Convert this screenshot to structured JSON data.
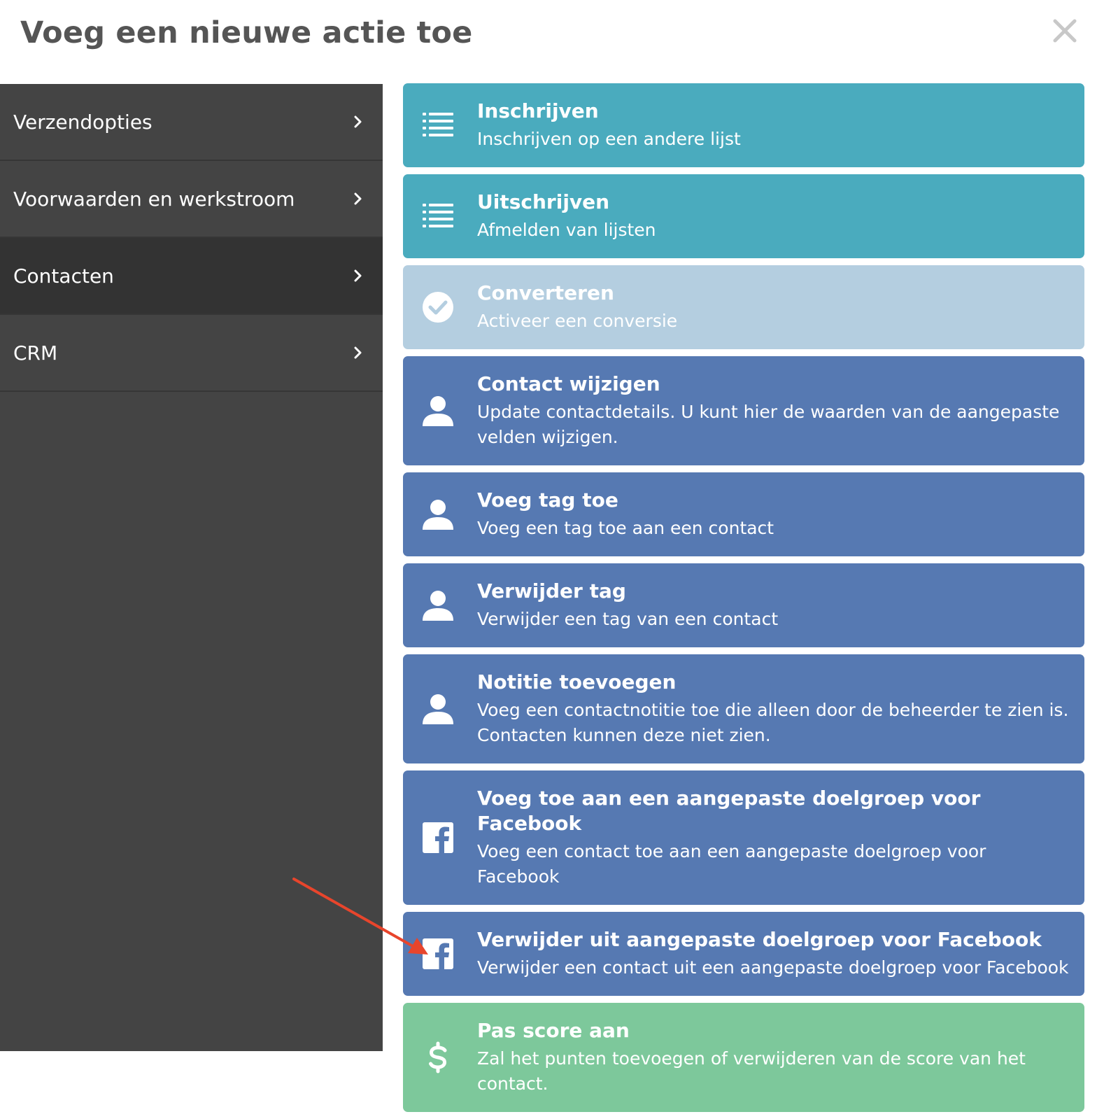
{
  "dialog": {
    "title": "Voeg een nieuwe actie toe"
  },
  "sidebar": {
    "items": [
      {
        "label": "Verzendopties"
      },
      {
        "label": "Voorwaarden en werkstroom"
      },
      {
        "label": "Contacten",
        "active": true
      },
      {
        "label": "CRM"
      }
    ]
  },
  "actions": [
    {
      "title": "Inschrijven",
      "desc": "Inschrijven op een andere lijst",
      "icon": "list-icon",
      "color": "#4aabbe"
    },
    {
      "title": "Uitschrijven",
      "desc": "Afmelden van lijsten",
      "icon": "list-icon",
      "color": "#4aabbe"
    },
    {
      "title": "Converteren",
      "desc": "Activeer een conversie",
      "icon": "check-circle-icon",
      "color": "#b4cee0"
    },
    {
      "title": "Contact wijzigen",
      "desc": "Update contactdetails. U kunt hier de waarden van de aangepaste velden wijzigen.",
      "icon": "user-icon",
      "color": "#5679b2"
    },
    {
      "title": "Voeg tag toe",
      "desc": "Voeg een tag toe aan een contact",
      "icon": "user-icon",
      "color": "#5679b2"
    },
    {
      "title": "Verwijder tag",
      "desc": "Verwijder een tag van een contact",
      "icon": "user-icon",
      "color": "#5679b2"
    },
    {
      "title": "Notitie toevoegen",
      "desc": "Voeg een contactnotitie toe die alleen door de beheerder te zien is. Contacten kunnen deze niet zien.",
      "icon": "user-icon",
      "color": "#5679b2"
    },
    {
      "title": "Voeg toe aan een aangepaste doelgroep voor Facebook",
      "desc": "Voeg een contact toe aan een aangepaste doelgroep voor Facebook",
      "icon": "facebook-icon",
      "color": "#5679b2"
    },
    {
      "title": "Verwijder uit aangepaste doelgroep voor Facebook",
      "desc": "Verwijder een contact uit een aangepaste doelgroep voor Facebook",
      "icon": "facebook-icon",
      "color": "#5679b2"
    },
    {
      "title": "Pas score aan",
      "desc": "Zal het punten toevoegen of verwijderen van de score van het contact.",
      "icon": "dollar-icon",
      "color": "#7dc89b"
    }
  ],
  "annotation": {
    "arrow_color": "#e8452c"
  }
}
